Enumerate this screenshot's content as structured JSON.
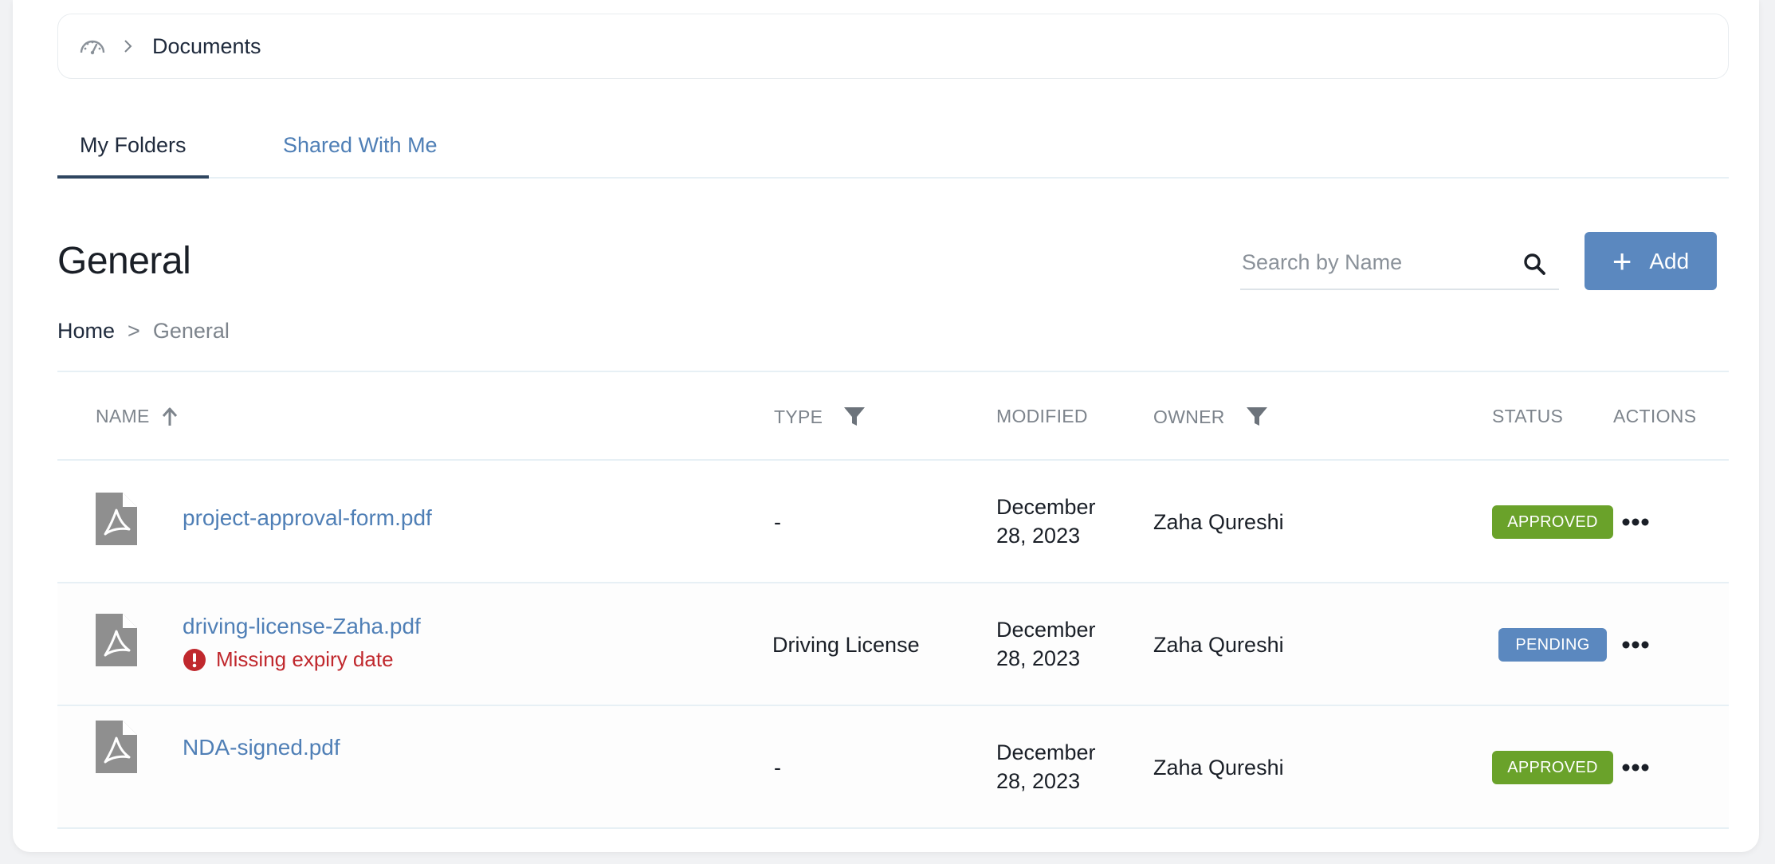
{
  "top_breadcrumb": {
    "label": "Documents"
  },
  "tabs": [
    {
      "label": "My Folders",
      "active": true
    },
    {
      "label": "Shared With Me",
      "active": false
    }
  ],
  "section": {
    "title": "General"
  },
  "search": {
    "placeholder": "Search by Name",
    "value": ""
  },
  "add_button": {
    "label": "Add"
  },
  "breadcrumb": {
    "home": "Home",
    "separator": ">",
    "current": "General"
  },
  "table": {
    "columns": {
      "name": "NAME",
      "type": "TYPE",
      "modified": "MODIFIED",
      "owner": "OWNER",
      "status": "STATUS",
      "actions": "ACTIONS"
    },
    "rows": [
      {
        "name": "project-approval-form.pdf",
        "warning": "",
        "type": "-",
        "modified_line1": "December",
        "modified_line2": "28, 2023",
        "owner": "Zaha Qureshi",
        "status": "APPROVED"
      },
      {
        "name": "driving-license-Zaha.pdf",
        "warning": "Missing expiry date",
        "type": "Driving License",
        "modified_line1": "December",
        "modified_line2": "28, 2023",
        "owner": "Zaha Qureshi",
        "status": "PENDING"
      },
      {
        "name": "NDA-signed.pdf",
        "warning": "",
        "type": "-",
        "modified_line1": "December",
        "modified_line2": "28, 2023",
        "owner": "Zaha Qureshi",
        "status": "APPROVED"
      }
    ]
  },
  "colors": {
    "link": "#4f7fb6",
    "approved": "#6aa22a",
    "pending": "#5b88bf",
    "warning": "#c0282d",
    "add_button": "#5b88bf"
  },
  "icons": {
    "dashboard": "speedometer-icon",
    "chevron": "chevron-right-icon",
    "search": "search-icon",
    "sort": "arrow-up-icon",
    "filter": "filter-icon",
    "file": "pdf-file-icon",
    "warning": "exclamation-circle-icon",
    "more": "more-horizontal-icon"
  }
}
